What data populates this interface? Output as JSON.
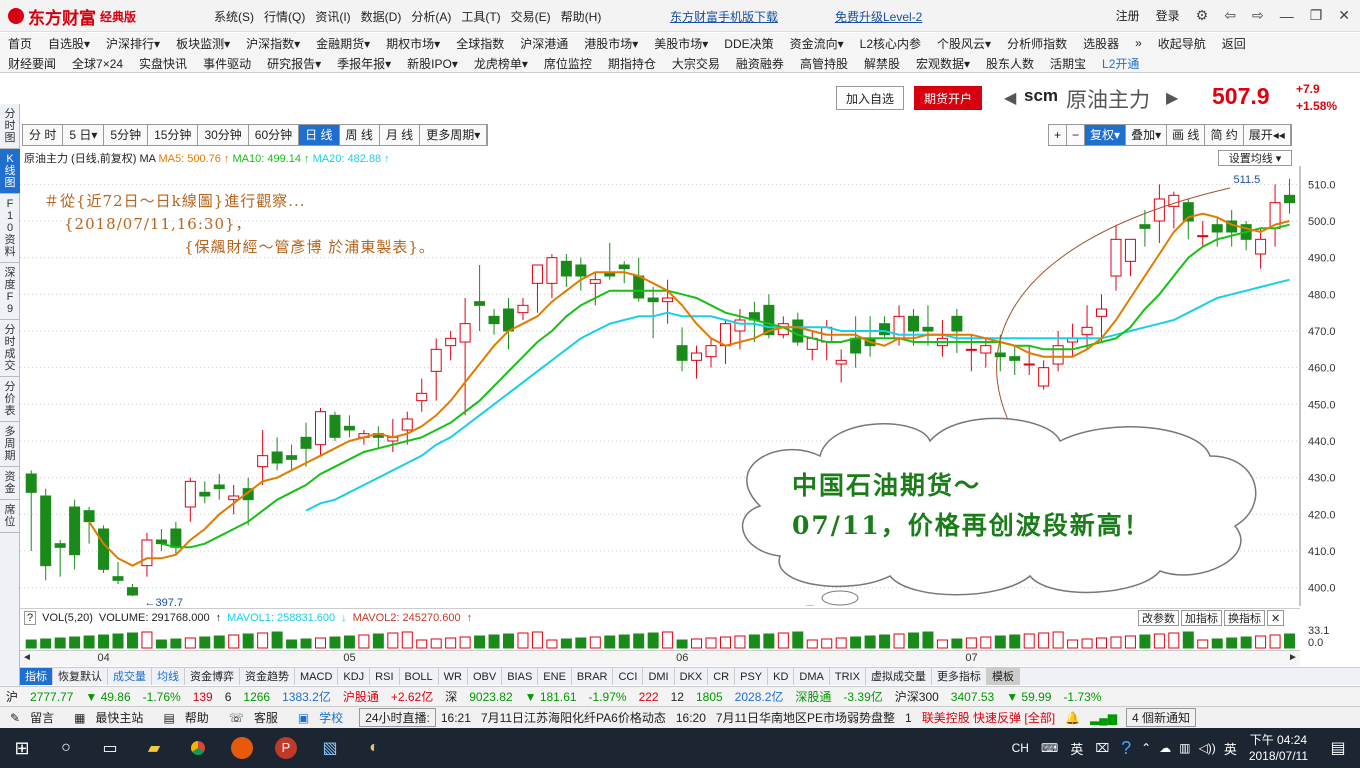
{
  "app": {
    "brand": "东方财富",
    "edition": "经典版"
  },
  "topmenu": [
    "系统(S)",
    "行情(Q)",
    "资讯(I)",
    "数据(D)",
    "分析(A)",
    "工具(T)",
    "交易(E)",
    "帮助(H)"
  ],
  "toplinks": {
    "mobile": "东方财富手机版下载",
    "level2": "免费升级Level-2"
  },
  "window": {
    "register": "注册",
    "login": "登录"
  },
  "nav_row1": [
    "首页",
    "自选股▾",
    "沪深排行▾",
    "板块监测▾",
    "沪深指数▾",
    "金融期货▾",
    "期权市场▾",
    "全球指数",
    "沪深港通",
    "港股市场▾",
    "美股市场▾",
    "DDE决策",
    "资金流向▾",
    "L2核心内参",
    "个股风云▾",
    "分析师指数",
    "选股器",
    "»",
    "收起导航",
    "返回"
  ],
  "nav_row2": [
    "财经要闻",
    "全球7×24",
    "实盘快讯",
    "事件驱动",
    "研究报告▾",
    "季报年报▾",
    "新股IPO▾",
    "龙虎榜单▾",
    "席位监控",
    "期指持仓",
    "大宗交易",
    "融资融券",
    "高管持股",
    "解禁股",
    "宏观数据▾",
    "股东人数",
    "活期宝",
    "L2开通"
  ],
  "leftbar": [
    "分时图",
    "K线图",
    "F10资料",
    "深度F9",
    "分时成交",
    "分价表",
    "多周期",
    "资金",
    "席位"
  ],
  "quote": {
    "add_watch": "加入自选",
    "futures_open": "期货开户",
    "code": "scm",
    "name": "原油主力",
    "price": "507.9",
    "change": "+7.9",
    "change_pct": "+1.58%"
  },
  "periods": [
    "分 时",
    "5 日▾",
    "5分钟",
    "15分钟",
    "30分钟",
    "60分钟",
    "日 线",
    "周 线",
    "月 线",
    "更多周期▾"
  ],
  "rightcontrols": [
    "+",
    "−",
    "复权▾",
    "叠加▾",
    "画 线",
    "简 约",
    "展开◂◂"
  ],
  "ma_legend": {
    "title": "原油主力 (日线,前复权)",
    "ma": "MA",
    "ma5": "MA5: 500.76",
    "ma10": "MA10: 499.14",
    "ma20": "MA20: 482.88"
  },
  "set_ma": "设置均线 ▾",
  "annotation": [
    "＃從{近72日～日k線圖}進行觀察...",
    "{2018/07/11,16:30}，",
    "{保飆財經～管彥博 於浦東製表}。"
  ],
  "cloud_text": [
    "中国石油期货～",
    "07/11，价格再创波段新高！"
  ],
  "price_labels": {
    "high": "511.5",
    "low": "397.7"
  },
  "chart_data": {
    "type": "candlestick",
    "title": "原油主力 (日线,前复权)",
    "y_ticks": [
      400,
      410,
      420,
      430,
      440,
      450,
      460,
      470,
      480,
      490,
      500,
      510
    ],
    "x_labels": [
      "04",
      "05",
      "06",
      "07"
    ],
    "candles_ohlc": [
      [
        431,
        432,
        410,
        426
      ],
      [
        425,
        427,
        402,
        406
      ],
      [
        412,
        413,
        403,
        411
      ],
      [
        422,
        424,
        405,
        409
      ],
      [
        421,
        422,
        412,
        418
      ],
      [
        416,
        417,
        404,
        405
      ],
      [
        403,
        407,
        401,
        402
      ],
      [
        400,
        401,
        397.7,
        398
      ],
      [
        406,
        415,
        403,
        413
      ],
      [
        413,
        416,
        410,
        412
      ],
      [
        416,
        418,
        409,
        411
      ],
      [
        422,
        430,
        418,
        429
      ],
      [
        426,
        429,
        423,
        425
      ],
      [
        428,
        431,
        424,
        427
      ],
      [
        424,
        428,
        420,
        425
      ],
      [
        427,
        430,
        417,
        424
      ],
      [
        433,
        443,
        428,
        436
      ],
      [
        437,
        441,
        432,
        434
      ],
      [
        436,
        439,
        432,
        435
      ],
      [
        441,
        445,
        433,
        438
      ],
      [
        439,
        449,
        436,
        448
      ],
      [
        447,
        448,
        440,
        441
      ],
      [
        444,
        447,
        441,
        443
      ],
      [
        441,
        443,
        439,
        442
      ],
      [
        442,
        444,
        438,
        441
      ],
      [
        440,
        446,
        437,
        441
      ],
      [
        443,
        448,
        439,
        446
      ],
      [
        451,
        457,
        448,
        453
      ],
      [
        459,
        468,
        451,
        465
      ],
      [
        466,
        470,
        462,
        468
      ],
      [
        467,
        479,
        447,
        472
      ],
      [
        478,
        488,
        470,
        477
      ],
      [
        474,
        476,
        469,
        472
      ],
      [
        476,
        479,
        465,
        470
      ],
      [
        475,
        479,
        473,
        477
      ],
      [
        483,
        488,
        475,
        488
      ],
      [
        483,
        491,
        479,
        490
      ],
      [
        489,
        491,
        482,
        485
      ],
      [
        488,
        490,
        481,
        485
      ],
      [
        483,
        486,
        477,
        484
      ],
      [
        486,
        494,
        484,
        485
      ],
      [
        488,
        489,
        483,
        487
      ],
      [
        485,
        490,
        478,
        479
      ],
      [
        479,
        482,
        468,
        478
      ],
      [
        478,
        484,
        472,
        479
      ],
      [
        466,
        471,
        459,
        462
      ],
      [
        462,
        466,
        457,
        464
      ],
      [
        463,
        468,
        460,
        466
      ],
      [
        466,
        473,
        461,
        472
      ],
      [
        470,
        476,
        465,
        473
      ],
      [
        475,
        478,
        467,
        473
      ],
      [
        477,
        480,
        468,
        469
      ],
      [
        469,
        474,
        468,
        472
      ],
      [
        473,
        475,
        466,
        467
      ],
      [
        465,
        470,
        462,
        468
      ],
      [
        467,
        473,
        462,
        471
      ],
      [
        461,
        465,
        456,
        462
      ],
      [
        468,
        474,
        460,
        464
      ],
      [
        468,
        474,
        463,
        466
      ],
      [
        472,
        474,
        468,
        469
      ],
      [
        468,
        477,
        466,
        474
      ],
      [
        474,
        476,
        466,
        470
      ],
      [
        471,
        477,
        466,
        470
      ],
      [
        466,
        473,
        463,
        468
      ],
      [
        474,
        476,
        464,
        470
      ],
      [
        465,
        469,
        459,
        465
      ],
      [
        464,
        468,
        460,
        466
      ],
      [
        464,
        469,
        459,
        463
      ],
      [
        463,
        466,
        458,
        462
      ],
      [
        461,
        466,
        458,
        461
      ],
      [
        455,
        462,
        454,
        460
      ],
      [
        461,
        470,
        459,
        466
      ],
      [
        467,
        472,
        463,
        468
      ],
      [
        469,
        477,
        465,
        471
      ],
      [
        474,
        480,
        467,
        476
      ],
      [
        485,
        499,
        481,
        495
      ],
      [
        489,
        494,
        485,
        495
      ],
      [
        499,
        503,
        493,
        498
      ],
      [
        500,
        510,
        494,
        506
      ],
      [
        504,
        508,
        498,
        507
      ],
      [
        505,
        506,
        495,
        500
      ],
      [
        496,
        500,
        493,
        496
      ],
      [
        499,
        501,
        493,
        497
      ],
      [
        500,
        503,
        493,
        497
      ],
      [
        499,
        500,
        492,
        495
      ],
      [
        491,
        498,
        487,
        495
      ],
      [
        498,
        510,
        493,
        505
      ],
      [
        507,
        511.5,
        502,
        505
      ]
    ],
    "ma5": [
      null,
      null,
      null,
      null,
      418,
      412,
      408,
      406,
      408,
      408,
      409,
      413,
      416,
      420,
      423,
      426,
      429,
      430,
      432,
      434,
      436,
      438,
      440,
      441,
      442,
      441,
      442,
      444,
      447,
      451,
      456,
      461,
      466,
      470,
      472,
      474,
      478,
      481,
      484,
      486,
      486,
      486,
      485,
      483,
      481,
      477,
      472,
      468,
      466,
      467,
      468,
      470,
      471,
      471,
      470,
      469,
      469,
      469,
      467,
      466,
      468,
      468,
      469,
      469,
      469,
      469,
      468,
      467,
      466,
      464,
      463,
      463,
      463,
      465,
      468,
      473,
      479,
      485,
      491,
      497,
      501,
      502,
      501,
      499,
      498,
      497,
      499,
      500
    ],
    "ma10": [
      null,
      null,
      null,
      null,
      null,
      null,
      null,
      null,
      null,
      412,
      411,
      411,
      412,
      414,
      416,
      418,
      421,
      424,
      426,
      428,
      431,
      433,
      435,
      437,
      438,
      439,
      440,
      441,
      443,
      445,
      448,
      451,
      455,
      459,
      463,
      467,
      470,
      474,
      477,
      479,
      481,
      481,
      481,
      481,
      481,
      480,
      479,
      477,
      475,
      474,
      473,
      472,
      471,
      469,
      468,
      467,
      467,
      468,
      468,
      468,
      468,
      467,
      467,
      467,
      467,
      467,
      467,
      467,
      466,
      466,
      465,
      465,
      465,
      466,
      467,
      468,
      471,
      476,
      480,
      485,
      490,
      493,
      495,
      496,
      497,
      498,
      498,
      499
    ],
    "ma20": [
      null,
      null,
      null,
      null,
      null,
      null,
      null,
      null,
      null,
      null,
      null,
      null,
      null,
      null,
      null,
      null,
      null,
      null,
      null,
      421,
      423,
      424,
      426,
      428,
      430,
      432,
      434,
      436,
      439,
      441,
      444,
      447,
      450,
      453,
      456,
      459,
      462,
      465,
      468,
      470,
      472,
      473,
      474,
      474,
      475,
      474,
      474,
      474,
      473,
      472,
      472,
      471,
      471,
      471,
      471,
      471,
      470,
      470,
      470,
      470,
      469,
      469,
      469,
      469,
      468,
      468,
      468,
      468,
      468,
      468,
      468,
      468,
      468,
      468,
      468,
      469,
      470,
      471,
      472,
      473,
      475,
      477,
      479,
      480,
      481,
      482,
      483,
      484
    ]
  },
  "volume": {
    "legend": "VOL(5,20)",
    "volume": "VOLUME: 291768.000",
    "mavol1": "MAVOL1: 258831.600",
    "mavol2": "MAVOL2: 245270.600",
    "scale_hi": "33.1",
    "scale_lo": "0.0",
    "btns": [
      "改参数",
      "加指标",
      "换指标",
      "✕"
    ]
  },
  "indicators": [
    "指标",
    "恢复默认",
    "成交量",
    "均线",
    "资金博弈",
    "资金趋势",
    "MACD",
    "KDJ",
    "RSI",
    "BOLL",
    "WR",
    "OBV",
    "BIAS",
    "ENE",
    "BRAR",
    "CCI",
    "DMI",
    "DKX",
    "CR",
    "PSY",
    "KD",
    "DMA",
    "TRIX",
    "虚拟成交量",
    "更多指标",
    "模板"
  ],
  "indexbar": {
    "sh_label": "沪",
    "sh_price": "2777.77",
    "sh_chg": "▼ 49.86",
    "sh_pct": "-1.76%",
    "sh_a": "139",
    "sh_b": "6",
    "sh_c": "1266",
    "sh_amt": "1383.2亿",
    "hgt_label": "沪股通",
    "hgt_val": "+2.62亿",
    "sz_label": "深",
    "sz_price": "9023.82",
    "sz_chg": "▼ 181.61",
    "sz_pct": "-1.97%",
    "sz_a": "222",
    "sz_b": "12",
    "sz_c": "1805",
    "sz_amt": "2028.2亿",
    "sgt_label": "深股通",
    "sgt_val": "-3.39亿",
    "hs_label": "沪深300",
    "hs_price": "3407.53",
    "hs_chg": "▼ 59.99",
    "hs_pct": "-1.73%"
  },
  "statusbar": {
    "items": [
      "留言",
      "最快主站",
      "帮助",
      "客服",
      "学校"
    ],
    "live": "24小时直播:",
    "t1": "16:21",
    "n1": "7月11日江苏海阳化纤PA6价格动态",
    "t2": "16:20",
    "n2": "7月11日华南地区PE市场弱势盘整",
    "idx": "1",
    "alert": "联美控股 快速反弹 [全部]",
    "notice": "4 個新通知"
  },
  "taskbar": {
    "lang": "CH",
    "ime": "英",
    "ime2": "英",
    "time": "下午 04:24",
    "date": "2018/07/11"
  }
}
